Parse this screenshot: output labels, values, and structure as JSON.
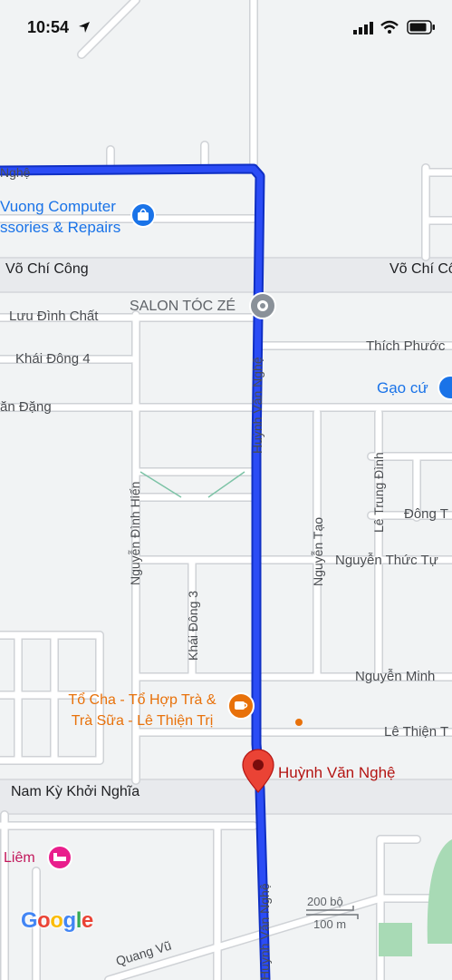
{
  "status_bar": {
    "time": "10:54"
  },
  "streets": {
    "vo_chi_cong_left": "Võ Chí Công",
    "vo_chi_cong_right": "Võ Chí Công",
    "luu_dinh_chat": "Lưu Đình Chất",
    "khai_dong_4": "Khái Đông 4",
    "van_dang": "ăn Đặng",
    "thich_phuoc": "Thích Phước",
    "dong_t": "Đông T",
    "nguyen_thuc_tu": "Nguyễn Thức Tự",
    "nguyen_minh": "Nguyễn Minh",
    "le_thien_right": "Lê Thiện T",
    "nam_ky_khoi_nghia": "Nam Kỳ Khởi Nghĩa",
    "huynh_van_nghe_upper": "Huỳnh Văn Nghệ",
    "huynh_van_nghe_lower": "Huỳnh Văn Nghệ",
    "nguyen_dinh_hien": "Nguyễn Đình Hiến",
    "khai_dong_3": "Khái Đông 3",
    "nguyen_tao": "Nguyễn Tạo",
    "le_trung_dinh": "Lê Trung Đình",
    "quang_vu": "Quang Vũ",
    "nghe_partial": "Nghệ"
  },
  "pois": {
    "computer_line1": "Vuong Computer",
    "computer_line2": "ssories & Repairs",
    "salon": "SALON TÓC ZÉ",
    "gao_cu": "Gạo cứ",
    "to_cha_line1": "Tổ Cha - Tổ Hợp Trà &",
    "to_cha_line2": "Trà Sữa - Lê Thiện Trị",
    "liem": "Liêm",
    "destination": "Huỳnh Văn Nghệ"
  },
  "scale": {
    "imperial": "200 bộ",
    "metric": "100 m"
  },
  "branding": {
    "logo": "Google"
  },
  "colors": {
    "route": "#1a3cf0",
    "road": "#ffffff",
    "major_road": "#dadce0",
    "destination_pin": "#ea4335",
    "poi_blue": "#1a73e8",
    "poi_orange": "#e8710a",
    "poi_pink": "#e91e8c",
    "poi_gray": "#8a9199",
    "park": "#a8dab5"
  }
}
